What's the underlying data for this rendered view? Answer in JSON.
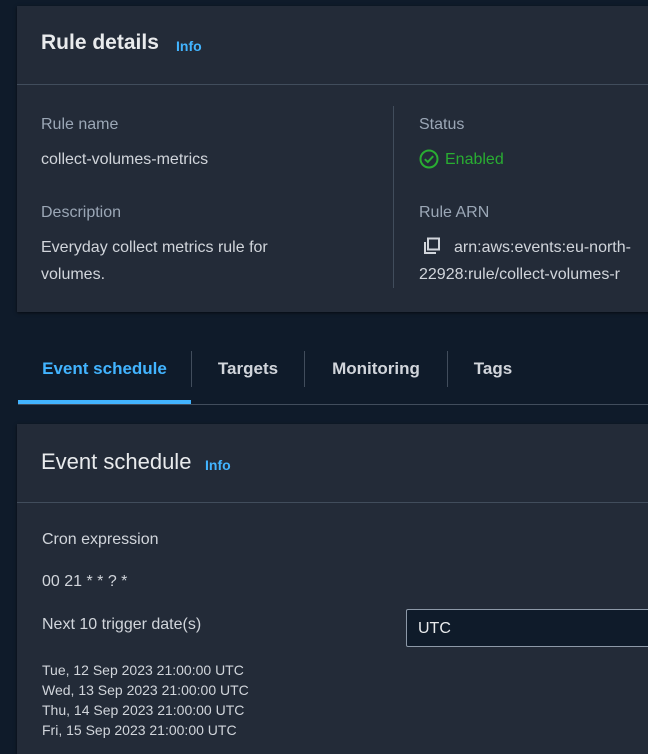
{
  "rule_details": {
    "title": "Rule details",
    "info_label": "Info",
    "rule_name_label": "Rule name",
    "rule_name_value": "collect-volumes-metrics",
    "description_label": "Description",
    "description_value": "Everyday collect metrics rule for volumes.",
    "status_label": "Status",
    "status_value": "Enabled",
    "rule_arn_label": "Rule ARN",
    "rule_arn_line1": "arn:aws:events:eu-north-",
    "rule_arn_line2": "22928:rule/collect-volumes-r"
  },
  "tabs": [
    {
      "label": "Event schedule",
      "active": true
    },
    {
      "label": "Targets",
      "active": false
    },
    {
      "label": "Monitoring",
      "active": false
    },
    {
      "label": "Tags",
      "active": false
    }
  ],
  "event_schedule": {
    "title": "Event schedule",
    "info_label": "Info",
    "cron_label": "Cron expression",
    "cron_value": "00 21 * * ? *",
    "next_label": "Next 10 trigger date(s)",
    "timezone_value": "UTC",
    "dates": [
      "Tue, 12 Sep 2023 21:00:00 UTC",
      "Wed, 13 Sep 2023 21:00:00 UTC",
      "Thu, 14 Sep 2023 21:00:00 UTC",
      "Fri, 15 Sep 2023 21:00:00 UTC"
    ]
  },
  "colors": {
    "accent": "#42b4ff",
    "success": "#29ad32",
    "panel": "#232b38",
    "background": "#0f1b2a"
  }
}
